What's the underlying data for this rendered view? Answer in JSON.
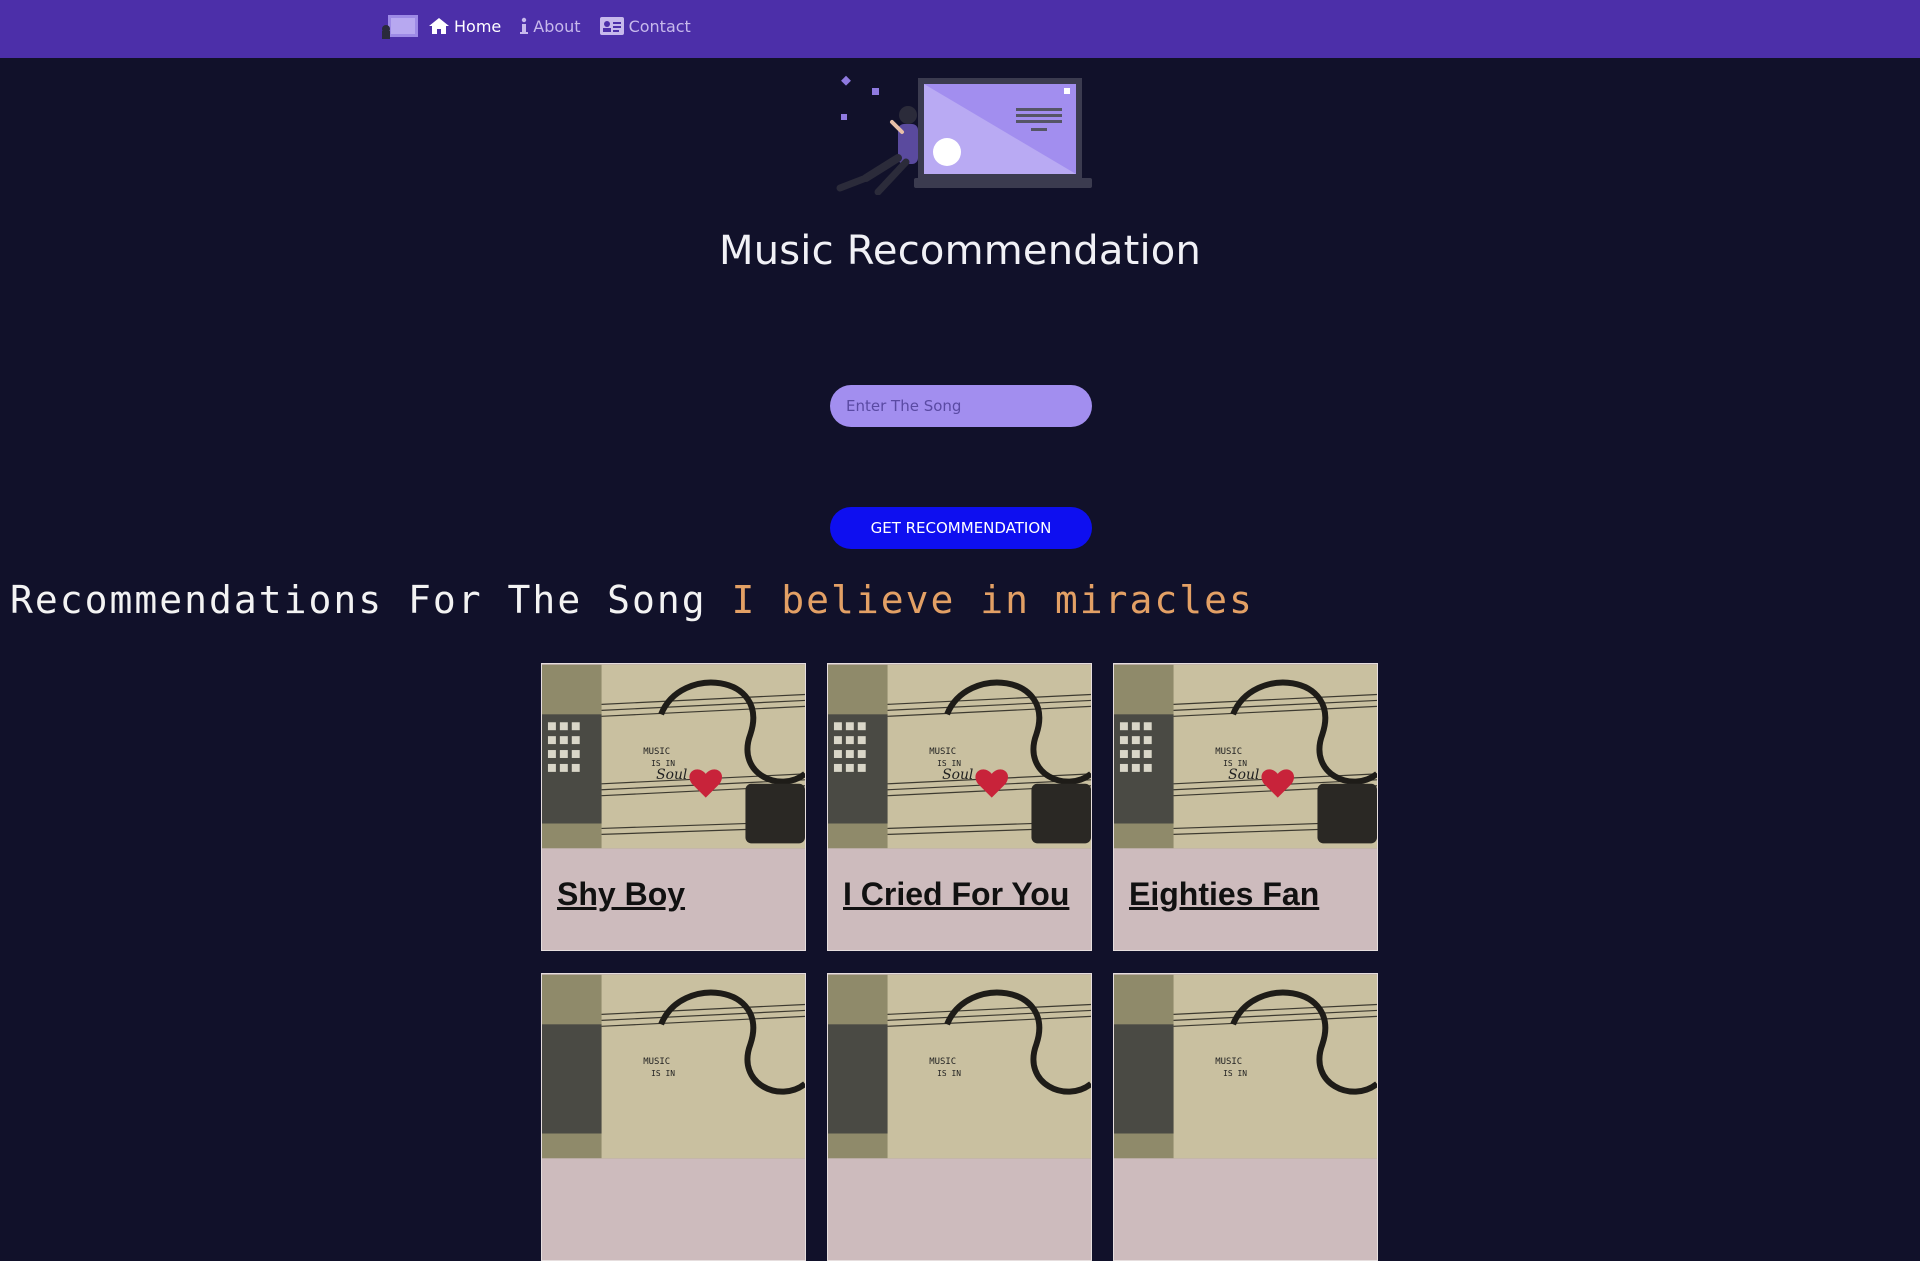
{
  "nav": {
    "logo_icon": "music-logo-icon",
    "links": [
      {
        "label": "Home",
        "icon": "home-icon",
        "active": true
      },
      {
        "label": "About",
        "icon": "info-icon",
        "active": false
      },
      {
        "label": "Contact",
        "icon": "contact-card-icon",
        "active": false
      }
    ]
  },
  "hero": {
    "illustration_icon": "person-with-laptop-illustration",
    "title": "Music Recommendation"
  },
  "search": {
    "placeholder": "Enter The Song",
    "value": ""
  },
  "button": {
    "label": "GET RECOMMENDATION"
  },
  "recommendations": {
    "heading_prefix": "Recommendations For The Song",
    "song": "I believe in miracles",
    "cards": [
      {
        "title": "Shy Boy"
      },
      {
        "title": "I Cried For You"
      },
      {
        "title": "Eighties Fan"
      },
      {
        "title": ""
      },
      {
        "title": ""
      },
      {
        "title": ""
      }
    ]
  },
  "colors": {
    "navbar": "#4c2fa9",
    "background": "#11112a",
    "input": "#a28eef",
    "button": "#0e0ff0",
    "song_highlight": "#e3a065",
    "card": "#cdbbbd"
  }
}
